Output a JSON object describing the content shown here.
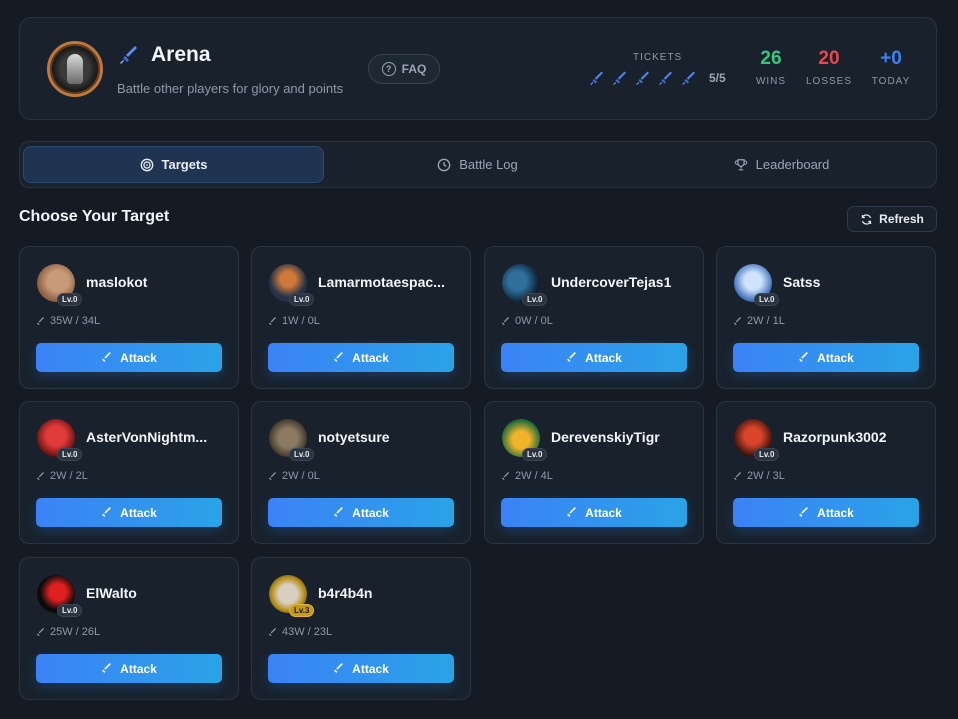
{
  "header": {
    "title": "Arena",
    "subtitle": "Battle other players for glory and points",
    "faq_label": "FAQ",
    "tickets_label": "TICKETS",
    "tickets_count": "5/5",
    "stats": [
      {
        "value": "26",
        "label": "WINS",
        "color": "#3bc47f"
      },
      {
        "value": "20",
        "label": "LOSSES",
        "color": "#e5484d"
      },
      {
        "value": "+0",
        "label": "TODAY",
        "color": "#3b82f6"
      }
    ]
  },
  "tabs": [
    {
      "label": "Targets",
      "icon": "target-icon",
      "active": true
    },
    {
      "label": "Battle Log",
      "icon": "clock-icon",
      "active": false
    },
    {
      "label": "Leaderboard",
      "icon": "trophy-icon",
      "active": false
    }
  ],
  "section": {
    "title": "Choose Your Target",
    "refresh_label": "Refresh"
  },
  "attack_label": "Attack",
  "players": [
    {
      "name": "maslokot",
      "level": "Lv.0",
      "record": "35W / 34L"
    },
    {
      "name": "Lamarmotaespac...",
      "level": "Lv.0",
      "record": "1W / 0L"
    },
    {
      "name": "UndercoverTejas1",
      "level": "Lv.0",
      "record": "0W / 0L"
    },
    {
      "name": "Satss",
      "level": "Lv.0",
      "record": "2W / 1L"
    },
    {
      "name": "AsterVonNightm...",
      "level": "Lv.0",
      "record": "2W / 2L"
    },
    {
      "name": "notyetsure",
      "level": "Lv.0",
      "record": "2W / 0L"
    },
    {
      "name": "DerevenskiyTigr",
      "level": "Lv.0",
      "record": "2W / 4L"
    },
    {
      "name": "Razorpunk3002",
      "level": "Lv.0",
      "record": "2W / 3L"
    },
    {
      "name": "ElWalto",
      "level": "Lv.0",
      "record": "25W / 26L"
    },
    {
      "name": "b4r4b4n",
      "level": "Lv.3",
      "record": "43W / 23L"
    }
  ]
}
